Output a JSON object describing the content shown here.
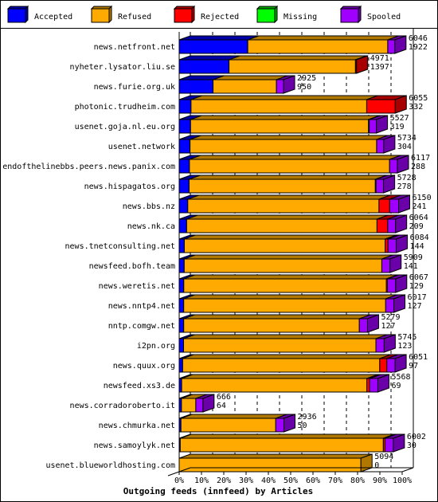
{
  "chart_data": {
    "type": "bar",
    "orientation": "horizontal-stacked-3d",
    "title": "Outgoing feeds (innfeed) by Articles",
    "xlabel": "",
    "ylabel": "",
    "xlim": [
      0,
      100
    ],
    "x_ticks": [
      "0%",
      "10%",
      "20%",
      "30%",
      "40%",
      "50%",
      "60%",
      "70%",
      "80%",
      "90%",
      "100%"
    ],
    "grid": true,
    "legend_position": "top",
    "legend": [
      {
        "name": "Accepted",
        "color": "#0000ff",
        "side": "#0000a8"
      },
      {
        "name": "Refused",
        "color": "#ffaa00",
        "side": "#b07800"
      },
      {
        "name": "Rejected",
        "color": "#ff0000",
        "side": "#a80000"
      },
      {
        "name": "Missing",
        "color": "#00ff00",
        "side": "#00a800"
      },
      {
        "name": "Spooled",
        "color": "#a000ff",
        "side": "#6a00a8"
      }
    ],
    "scale_max": 6250,
    "categories": [
      "news.netfront.net",
      "nyheter.lysator.liu.se",
      "news.furie.org.uk",
      "photonic.trudheim.com",
      "usenet.goja.nl.eu.org",
      "usenet.network",
      "endofthelinebbs.peers.news.panix.com",
      "news.hispagatos.org",
      "news.bbs.nz",
      "news.nk.ca",
      "news.tnetconsulting.net",
      "newsfeed.bofh.team",
      "news.weretis.net",
      "news.nntp4.net",
      "nntp.comgw.net",
      "i2pn.org",
      "news.quux.org",
      "newsfeed.xs3.de",
      "news.corradoroberto.it",
      "news.chmurka.net",
      "news.samoylyk.net",
      "usenet.blueworldhosting.com"
    ],
    "totals": [
      6046,
      4971,
      2925,
      6055,
      5527,
      5734,
      6117,
      5728,
      6150,
      6064,
      6084,
      5909,
      6067,
      6017,
      5279,
      5745,
      6051,
      5568,
      666,
      2936,
      6002,
      5094
    ],
    "accepted_labels": [
      1922,
      1397,
      950,
      332,
      319,
      304,
      288,
      278,
      241,
      209,
      144,
      141,
      129,
      127,
      127,
      123,
      97,
      69,
      64,
      50,
      30,
      0
    ],
    "series": [
      {
        "name": "Accepted",
        "values": [
          1922,
          1397,
          950,
          332,
          319,
          304,
          288,
          278,
          241,
          209,
          144,
          141,
          129,
          127,
          127,
          123,
          97,
          69,
          64,
          50,
          30,
          0
        ]
      },
      {
        "name": "Refused",
        "values": [
          3924,
          3544,
          1775,
          4923,
          4988,
          5230,
          5609,
          5220,
          5359,
          5335,
          5630,
          5538,
          5678,
          5660,
          4922,
          5392,
          5524,
          5189,
          402,
          2656,
          5692,
          5094
        ]
      },
      {
        "name": "Rejected",
        "values": [
          0,
          30,
          0,
          800,
          20,
          0,
          0,
          20,
          300,
          300,
          80,
          0,
          30,
          0,
          0,
          0,
          200,
          80,
          0,
          0,
          50,
          0
        ]
      },
      {
        "name": "Missing",
        "values": [
          0,
          0,
          0,
          0,
          0,
          0,
          0,
          0,
          0,
          0,
          0,
          0,
          0,
          0,
          0,
          0,
          0,
          0,
          0,
          0,
          0,
          0
        ]
      },
      {
        "name": "Spooled",
        "values": [
          200,
          0,
          200,
          0,
          200,
          200,
          220,
          210,
          250,
          220,
          230,
          230,
          230,
          230,
          230,
          230,
          230,
          230,
          200,
          230,
          230,
          0
        ]
      }
    ]
  }
}
